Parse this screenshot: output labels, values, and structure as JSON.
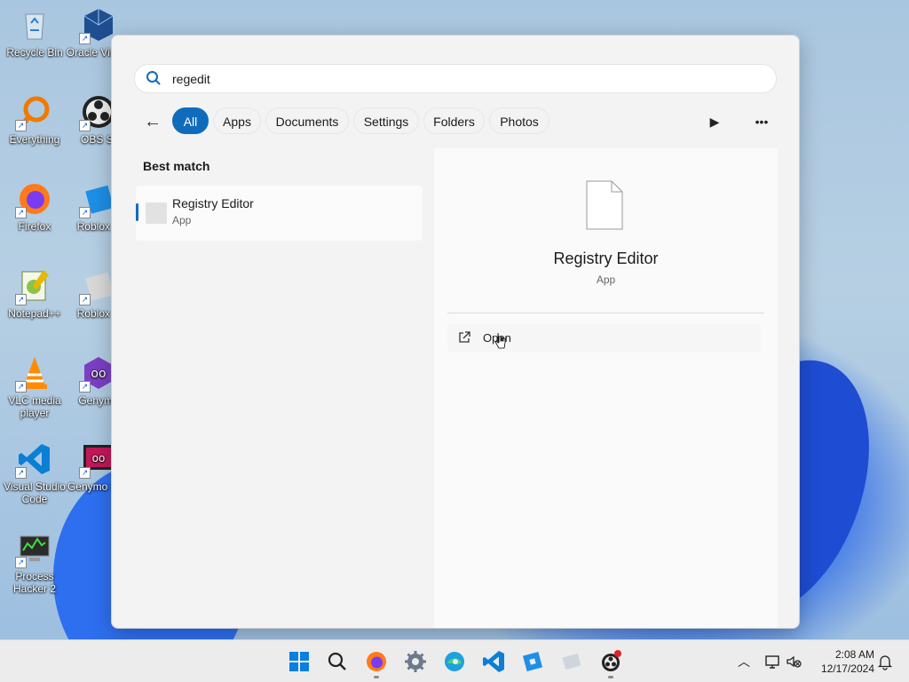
{
  "desktop": {
    "icons": [
      {
        "label": "Recycle Bin",
        "icon": "recycle-bin-icon"
      },
      {
        "label": "Oracle Virtual",
        "icon": "virtualbox-icon"
      },
      {
        "label": "Everything",
        "icon": "everything-icon"
      },
      {
        "label": "OBS St",
        "icon": "obs-icon"
      },
      {
        "label": "Firefox",
        "icon": "firefox-icon"
      },
      {
        "label": "Roblox S",
        "icon": "roblox-studio-icon"
      },
      {
        "label": "Notepad++",
        "icon": "notepadpp-icon"
      },
      {
        "label": "Roblox P",
        "icon": "roblox-player-icon"
      },
      {
        "label": "VLC media player",
        "icon": "vlc-icon"
      },
      {
        "label": "Genymo",
        "icon": "genymotion-icon"
      },
      {
        "label": "Visual Studio Code",
        "icon": "vscode-icon"
      },
      {
        "label": "Genymo She",
        "icon": "genymotion-shell-icon"
      },
      {
        "label": "Process Hacker 2",
        "icon": "process-hacker-icon"
      }
    ]
  },
  "search": {
    "query": "regedit",
    "filters": [
      "All",
      "Apps",
      "Documents",
      "Settings",
      "Folders",
      "Photos"
    ],
    "active_filter": "All"
  },
  "results": {
    "section_title": "Best match",
    "best_match": {
      "name": "Registry Editor",
      "kind": "App"
    }
  },
  "detail": {
    "title": "Registry Editor",
    "kind": "App",
    "actions": [
      {
        "label": "Open",
        "icon": "open-external-icon"
      }
    ]
  },
  "taskbar": {
    "apps": [
      "start-icon",
      "search-icon",
      "firefox-icon",
      "settings-icon",
      "edge-icon",
      "vscode-icon",
      "roblox-studio-icon",
      "roblox-player-icon",
      "obs-icon"
    ],
    "time": "2:08 AM",
    "date": "12/17/2024"
  }
}
